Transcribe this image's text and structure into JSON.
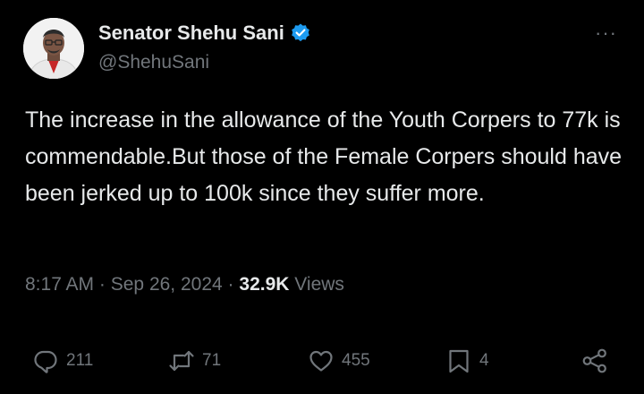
{
  "author": {
    "display_name": "Senator Shehu Sani",
    "handle": "@ShehuSani",
    "verified": true,
    "avatar_icon": "profile-photo"
  },
  "tweet": {
    "text": "The increase in the allowance of the Youth Corpers to 77k is commendable.But those of the Female Corpers should have been jerked up to 100k since they suffer more."
  },
  "meta": {
    "time": "8:17 AM",
    "separator": "·",
    "date": "Sep 26, 2024",
    "views_count": "32.9K",
    "views_label": "Views"
  },
  "actions": {
    "replies": "211",
    "reposts": "71",
    "likes": "455",
    "bookmarks": "4"
  },
  "colors": {
    "background": "#000000",
    "text": "#e7e9ea",
    "muted": "#71767b",
    "verified": "#1d9bf0"
  },
  "more_label": "···"
}
